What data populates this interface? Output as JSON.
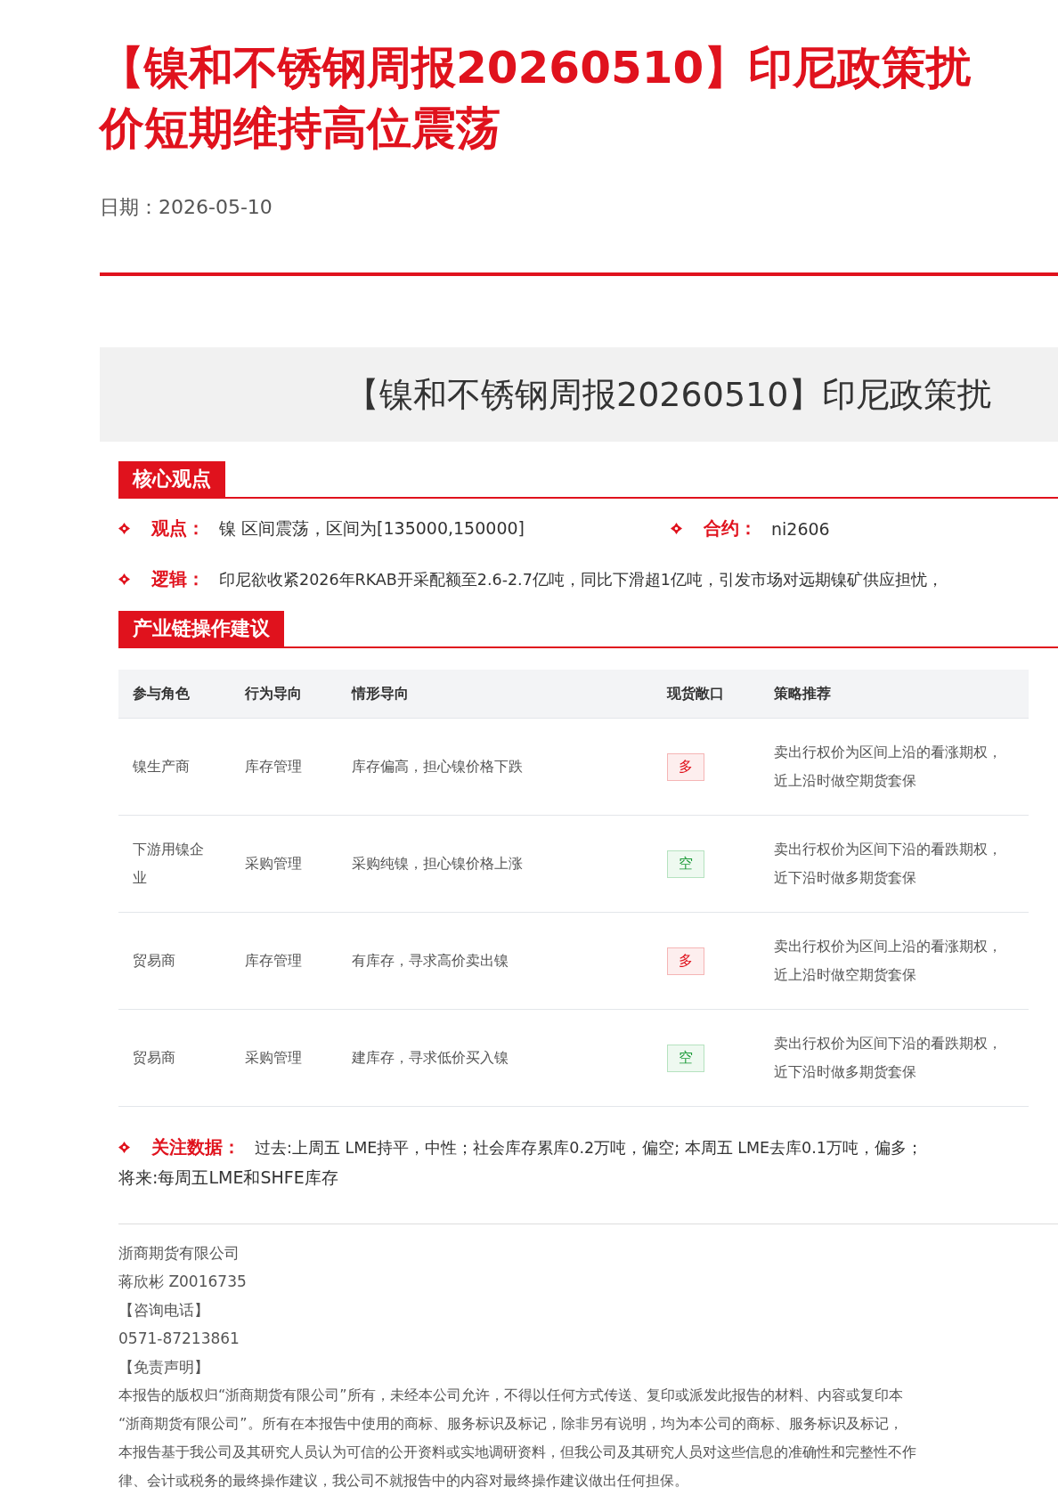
{
  "title_lines": [
    "【镍和不锈钢周报20260510】印尼政策扰",
    "价短期维持高位震荡"
  ],
  "date": {
    "label": "日期：",
    "value": "2026-05-10"
  },
  "banner": "【镍和不锈钢周报20260510】印尼政策扰",
  "core": {
    "heading": "核心观点",
    "view": {
      "label": "观点：",
      "value": "镍 区间震荡，区间为[135000,150000]"
    },
    "contract": {
      "label": "合约：",
      "value": "ni2606"
    },
    "logic": {
      "label": "逻辑：",
      "value": "印尼欲收紧2026年RKAB开采配额至2.6-2.7亿吨，同比下滑超1亿吨，引发市场对远期镍矿供应担忧，"
    }
  },
  "chain": {
    "heading": "产业链操作建议",
    "columns": [
      "参与角色",
      "行为导向",
      "情形导向",
      "现货敞口",
      "策略推荐"
    ],
    "rows": [
      {
        "role": "镍生产商",
        "behavior": "库存管理",
        "situation": "库存偏高，担心镍价格下跌",
        "exposure": {
          "text": "多",
          "kind": "long"
        },
        "strategy": "卖出行权价为区间上沿的看涨期权，近上沿时做空期货套保"
      },
      {
        "role": "下游用镍企业",
        "behavior": "采购管理",
        "situation": "采购纯镍，担心镍价格上涨",
        "exposure": {
          "text": "空",
          "kind": "short"
        },
        "strategy": "卖出行权价为区间下沿的看跌期权，近下沿时做多期货套保"
      },
      {
        "role": "贸易商",
        "behavior": "库存管理",
        "situation": "有库存，寻求高价卖出镍",
        "exposure": {
          "text": "多",
          "kind": "long"
        },
        "strategy": "卖出行权价为区间上沿的看涨期权，近上沿时做空期货套保"
      },
      {
        "role": "贸易商",
        "behavior": "采购管理",
        "situation": "建库存，寻求低价买入镍",
        "exposure": {
          "text": "空",
          "kind": "short"
        },
        "strategy": "卖出行权价为区间下沿的看跌期权，近下沿时做多期货套保"
      }
    ]
  },
  "watch": {
    "label": "关注数据：",
    "past": "过去:上周五 LME持平，中性；社会库存累库0.2万吨，偏空; 本周五 LME去库0.1万吨，偏多；",
    "future": "将来:每周五LME和SHFE库存"
  },
  "footer": {
    "lines": [
      "浙商期货有限公司",
      "蒋欣彬 Z0016735",
      "【咨询电话】",
      "0571-87213861",
      "【免责声明】"
    ],
    "disclaimer": [
      "本报告的版权归“浙商期货有限公司”所有，未经本公司允许，不得以任何方式传送、复印或派发此报告的材料、内容或复印本",
      "“浙商期货有限公司”。所有在本报告中使用的商标、服务标识及标记，除非另有说明，均为本公司的商标、服务标识及标记，",
      "本报告基于我公司及其研究人员认为可信的公开资料或实地调研资料，但我公司及其研究人员对这些信息的准确性和完整性不作",
      "律、会计或税务的最终操作建议，我公司不就报告中的内容对最终操作建议做出任何担保。"
    ]
  }
}
